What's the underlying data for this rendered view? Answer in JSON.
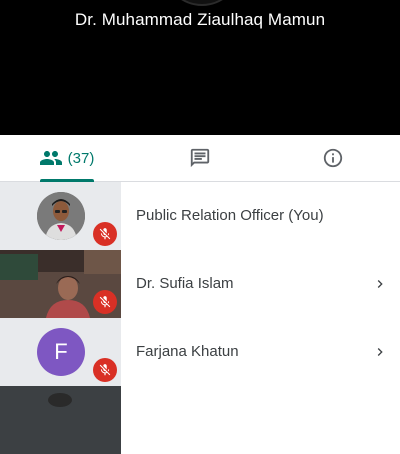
{
  "presenter": {
    "name": "Dr. Muhammad Ziaulhaq Mamun"
  },
  "tabs": {
    "people": {
      "icon": "people-icon",
      "count_label": "(37)",
      "selected": true
    },
    "chat": {
      "icon": "chat-icon"
    },
    "info": {
      "icon": "info-icon"
    }
  },
  "participants": [
    {
      "name": "Public Relation Officer (You)",
      "avatar": "photo",
      "muted": true,
      "has_chevron": false
    },
    {
      "name": "Dr. Sufia Islam",
      "avatar": "video",
      "muted": true,
      "has_chevron": true
    },
    {
      "name": "Farjana Khatun",
      "avatar_letter": "F",
      "muted": true,
      "has_chevron": true
    },
    {
      "name": "",
      "avatar": "video",
      "muted": false,
      "has_chevron": false
    }
  ],
  "colors": {
    "accent": "#00796b",
    "mute_badge": "#d93025",
    "letter_avatar": "#7e57c2"
  }
}
